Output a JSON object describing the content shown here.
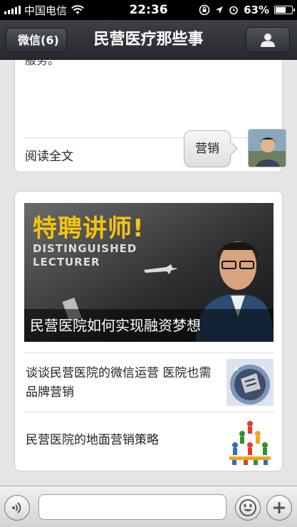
{
  "status_bar": {
    "carrier": "中国电信",
    "time": "22:36",
    "battery": "63%",
    "battery_level": 0.63
  },
  "nav": {
    "back_label": "微信(6)",
    "title": "民营医疗那些事",
    "profile_icon": "person-icon"
  },
  "messages": {
    "card1": {
      "truncated_text": "服务。",
      "read_more": "阅读全文",
      "chevron": "›"
    },
    "outgoing": {
      "text": "营销"
    },
    "card2": {
      "hero_headline": "特聘讲师!",
      "hero_sub": "DISTINGUISHED LECTURER",
      "hero_caption": "民营医院如何实现融资梦想",
      "articles": [
        {
          "title": "谈谈民营医院的微信运营 医院也需品牌营销"
        },
        {
          "title": "民营医院的地面营销策略"
        }
      ]
    }
  },
  "input_bar": {
    "placeholder": "",
    "voice_icon": "voice-icon",
    "emoji_icon": "emoji-icon",
    "plus_icon": "plus-icon"
  }
}
